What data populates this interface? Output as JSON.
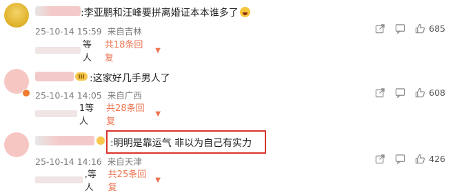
{
  "comments": [
    {
      "text": ":李亚鹏和汪峰要拼离婚证本本谁多了",
      "date": "25-10-14 15:59",
      "location": "来自吉林",
      "likes": "685",
      "reply_users": "等人",
      "reply_count": "共18条回复"
    },
    {
      "text": ":这家好几手男人了",
      "badge": "III",
      "date": "25-10-14 14:05",
      "location": "来自广西",
      "likes": "608",
      "reply_users": "1等人",
      "reply_count": "共28条回复"
    },
    {
      "text": ":明明是靠运气 非以为自己有实力",
      "date": "25-10-14 14:16",
      "location": "来自天津",
      "likes": "426",
      "reply_users": ",等人",
      "reply_count": "共25条回复"
    }
  ],
  "icons": {
    "share": "share-icon",
    "comment": "comment-icon",
    "like": "thumbs-up-icon",
    "dropdown": "caret-down-icon",
    "emoji": "laughing-emoji-icon"
  },
  "colors": {
    "accent": "#eb7350",
    "highlight_border": "#d9342b",
    "meta_text": "#7a7a7a",
    "redaction": "#f4c9c9"
  }
}
